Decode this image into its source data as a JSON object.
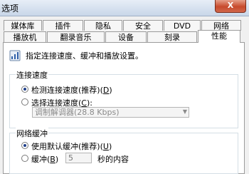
{
  "window": {
    "title": "选项",
    "close_glyph": "X"
  },
  "tabs_row1": [
    "媒体库",
    "插件",
    "隐私",
    "安全",
    "DVD",
    "网络"
  ],
  "tabs_row2": [
    "播放机",
    "翻录音乐",
    "设备",
    "刻录",
    "性能"
  ],
  "active_tab": "性能",
  "description": "指定连接速度、缓冲和播放设置。",
  "connection": {
    "legend": "连接速度",
    "detect_label": "检测连接速度(推荐)(",
    "detect_key": "D",
    "choose_label": "选择连接速度(",
    "choose_key": "C",
    "select_value": "调制解调器(28.8 Kbps)"
  },
  "buffer": {
    "legend": "网络缓冲",
    "default_label": "使用默认缓冲(推荐)(",
    "default_key": "U",
    "buffer_label": "缓冲(",
    "buffer_key": "B",
    "buffer_value": "5",
    "buffer_suffix": "秒的内容"
  }
}
